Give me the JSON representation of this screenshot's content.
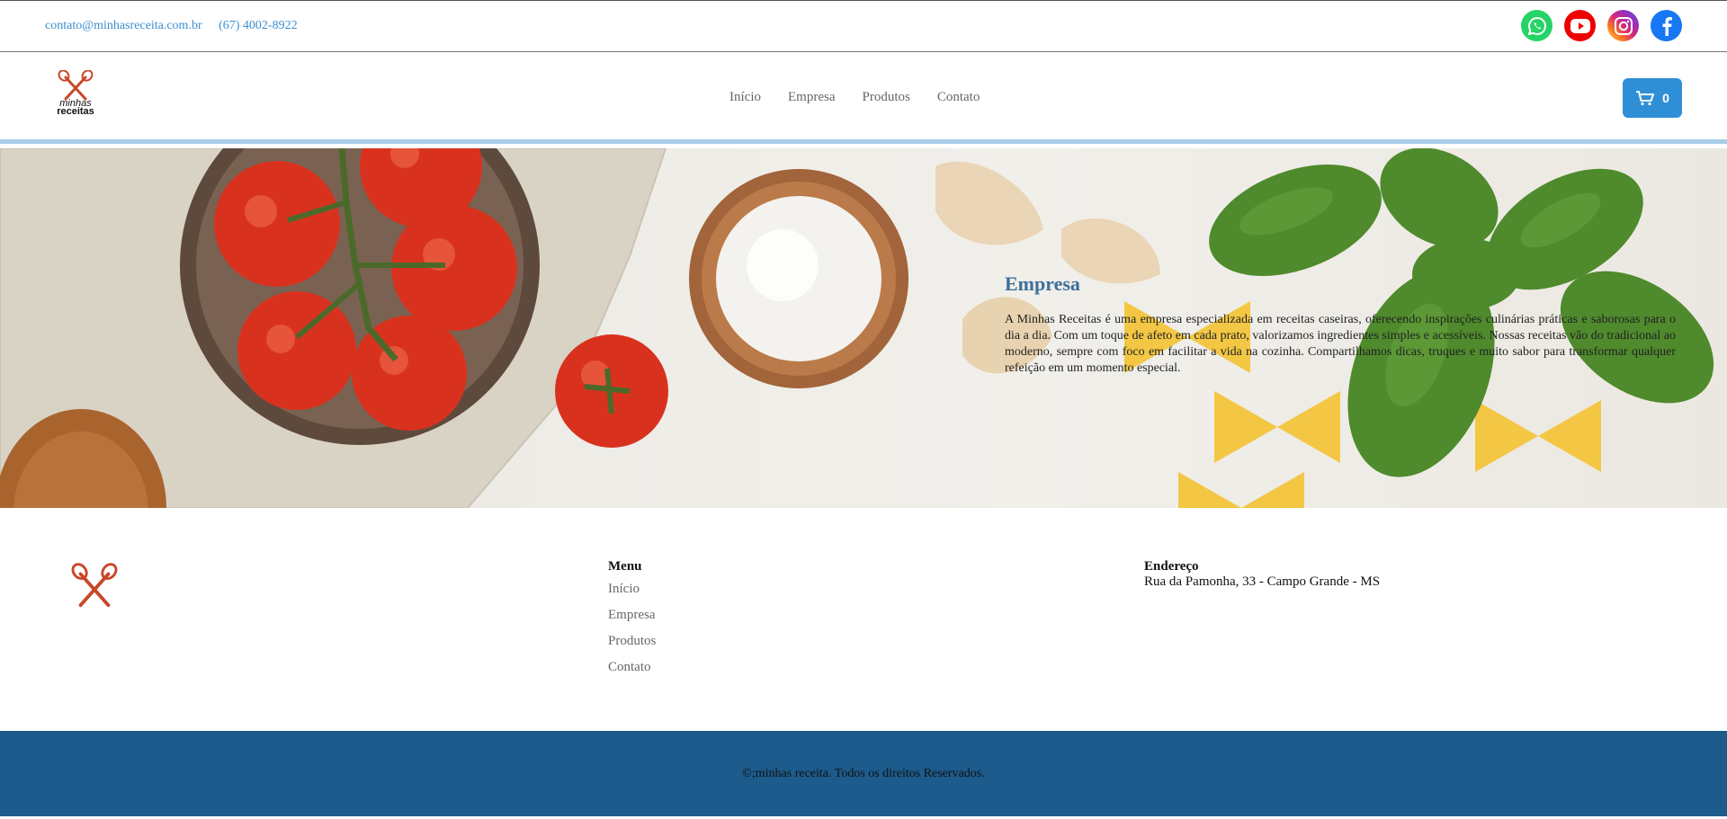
{
  "topbar": {
    "email": "contato@minhasreceita.com.br",
    "phone": "(67) 4002-8922",
    "social": [
      {
        "icon": "whatsapp-icon",
        "color": "#25d366"
      },
      {
        "icon": "youtube-icon",
        "color": "#ff0000"
      },
      {
        "icon": "instagram-icon",
        "color": "#d62976"
      },
      {
        "icon": "facebook-icon",
        "color": "#1877f2"
      }
    ]
  },
  "header": {
    "logo_text_line1": "minhas",
    "logo_text_line2": "receitas",
    "nav": [
      "Início",
      "Empresa",
      "Produtos",
      "Contato"
    ],
    "cart_count": "0",
    "accent": "#2f8fd6"
  },
  "hero": {
    "title": "Empresa",
    "text": "A Minhas Receitas é uma empresa especializada em receitas caseiras, oferecendo inspirações culinárias práticas e saborosas para o dia a dia. Com um toque de afeto em cada prato, valorizamos ingredientes simples e acessíveis. Nossas receitas vão do tradicional ao moderno, sempre com foco em facilitar a vida na cozinha. Compartilhamos dicas, truques e muito sabor para transformar qualquer refeição em um momento especial."
  },
  "footer": {
    "menu_title": "Menu",
    "menu_links": [
      "Início",
      "Empresa",
      "Produtos",
      "Contato"
    ],
    "address_title": "Endereço",
    "address": "Rua da Pamonha, 33 - Campo Grande - MS"
  },
  "copyright": {
    "text": "©;minhas receita. Todos os direitos Reservados.",
    "bg": "#1c5b8b"
  }
}
